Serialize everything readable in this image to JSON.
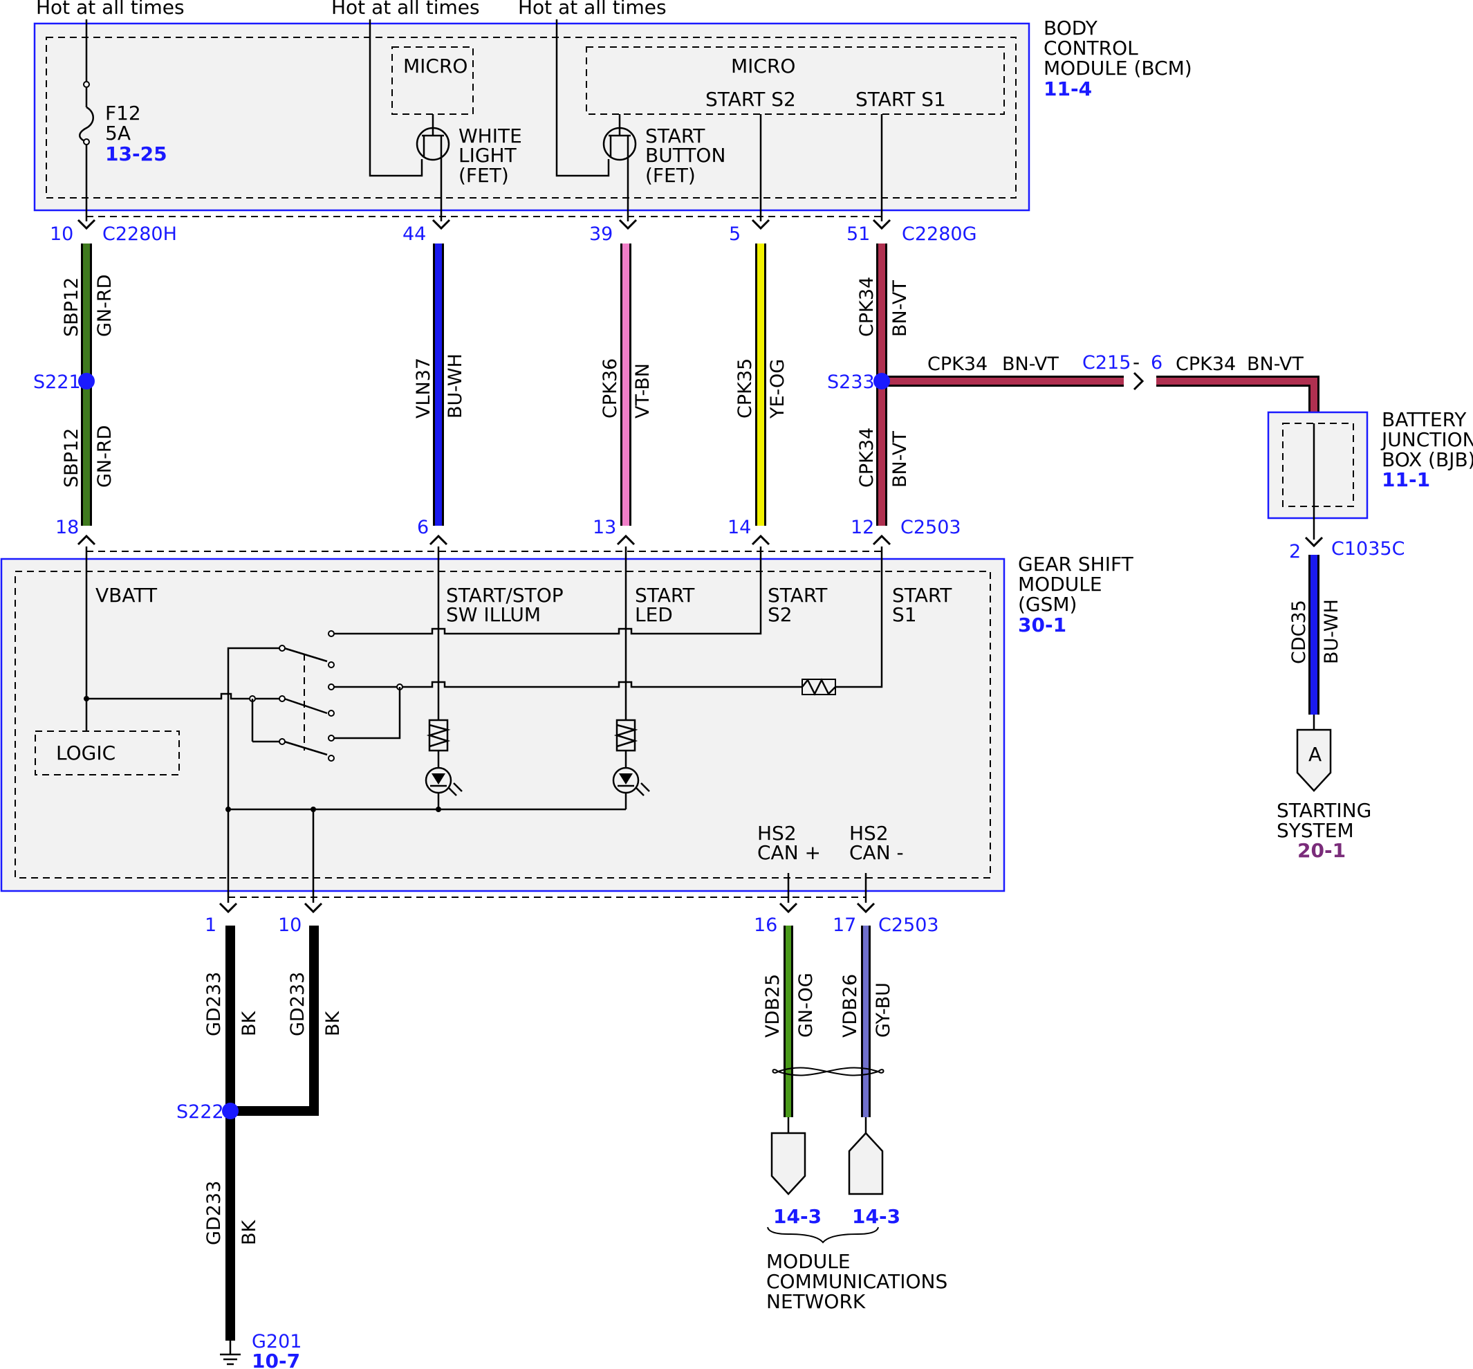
{
  "power": {
    "hot1": "Hot at all times",
    "hot2": "Hot at all times",
    "hot3": "Hot at all times"
  },
  "bcm": {
    "title_line1": "BODY",
    "title_line2": "CONTROL",
    "title_line3": "MODULE (BCM)",
    "ref": "11-4",
    "micro1": "MICRO",
    "micro2": "MICRO",
    "start_s2": "START S2",
    "start_s1": "START S1",
    "fuse_name": "F12",
    "fuse_rating": "5A",
    "fuse_ref": "13-25",
    "fet1_line1": "WHITE",
    "fet1_line2": "LIGHT",
    "fet1_line3": "(FET)",
    "fet2_line1": "START",
    "fet2_line2": "BUTTON",
    "fet2_line3": "(FET)"
  },
  "connectors": {
    "c2280h": "C2280H",
    "c2280g": "C2280G",
    "c2503_top": "C2503",
    "c2503_bottom": "C2503",
    "c215": "C215",
    "c215_dash": "-",
    "c215_pin": "6",
    "c1035c": "C1035C"
  },
  "pins": {
    "bcm": [
      "10",
      "44",
      "39",
      "5",
      "51"
    ],
    "gsm_top": [
      "18",
      "6",
      "13",
      "14",
      "12"
    ],
    "gsm_bottom": [
      "1",
      "10",
      "16",
      "17"
    ],
    "bjb": "2"
  },
  "wires": {
    "w1_upper": {
      "circuit": "SBP12",
      "color": "GN-RD"
    },
    "w1_lower": {
      "circuit": "SBP12",
      "color": "GN-RD"
    },
    "w2": {
      "circuit": "VLN37",
      "color": "BU-WH"
    },
    "w3": {
      "circuit": "CPK36",
      "color": "VT-BN"
    },
    "w4": {
      "circuit": "CPK35",
      "color": "YE-OG"
    },
    "w5_upper": {
      "circuit": "CPK34",
      "color": "BN-VT"
    },
    "w5_lower": {
      "circuit": "CPK34",
      "color": "BN-VT"
    },
    "w5_h1": {
      "circuit": "CPK34",
      "color": "BN-VT"
    },
    "w5_h2": {
      "circuit": "CPK34",
      "color": "BN-VT"
    },
    "bjb_out": {
      "circuit": "CDC35",
      "color": "BU-WH"
    },
    "gnd1": {
      "circuit": "GD233",
      "color": "BK"
    },
    "gnd2": {
      "circuit": "GD233",
      "color": "BK"
    },
    "gnd3": {
      "circuit": "GD233",
      "color": "BK"
    },
    "can_p": {
      "circuit": "VDB25",
      "color": "GN-OG"
    },
    "can_m": {
      "circuit": "VDB26",
      "color": "GY-BU"
    }
  },
  "splices": {
    "s221": "S221",
    "s233": "S233",
    "s222": "S222"
  },
  "bjb": {
    "title_line1": "BATTERY",
    "title_line2": "JUNCTION",
    "title_line3": "BOX (BJB)",
    "ref": "11-1"
  },
  "starting": {
    "letter": "A",
    "line1": "STARTING",
    "line2": "SYSTEM",
    "ref": "20-1"
  },
  "gsm": {
    "title_line1": "GEAR SHIFT",
    "title_line2": "MODULE",
    "title_line3": "(GSM)",
    "ref": "30-1",
    "vbatt": "VBATT",
    "illum_line1": "START/STOP",
    "illum_line2": "SW ILLUM",
    "led_line1": "START",
    "led_line2": "LED",
    "s2_line1": "START",
    "s2_line2": "S2",
    "s1_line1": "START",
    "s1_line2": "S1",
    "logic": "LOGIC",
    "canp_line1": "HS2",
    "canp_line2": "CAN +",
    "canm_line1": "HS2",
    "canm_line2": "CAN -"
  },
  "ground": {
    "name": "G201",
    "ref": "10-7"
  },
  "network": {
    "ref1": "14-3",
    "ref2": "14-3",
    "line1": "MODULE",
    "line2": "COMMUNICATIONS",
    "line3": "NETWORK"
  },
  "colors": {
    "GN-RD": "#3f7a1e",
    "BU-WH": "#1a1aee",
    "VT-BN": "#f07ec8",
    "YE-OG": "#f2f200",
    "BN-VT": "#b03050",
    "BK": "#000000",
    "GN-OG": "#4a9a1a",
    "GY-BU": "#7070cc",
    "link": "#1a1aff",
    "module_border": "#1a1aff",
    "module_fill": "#f2f2f2"
  }
}
